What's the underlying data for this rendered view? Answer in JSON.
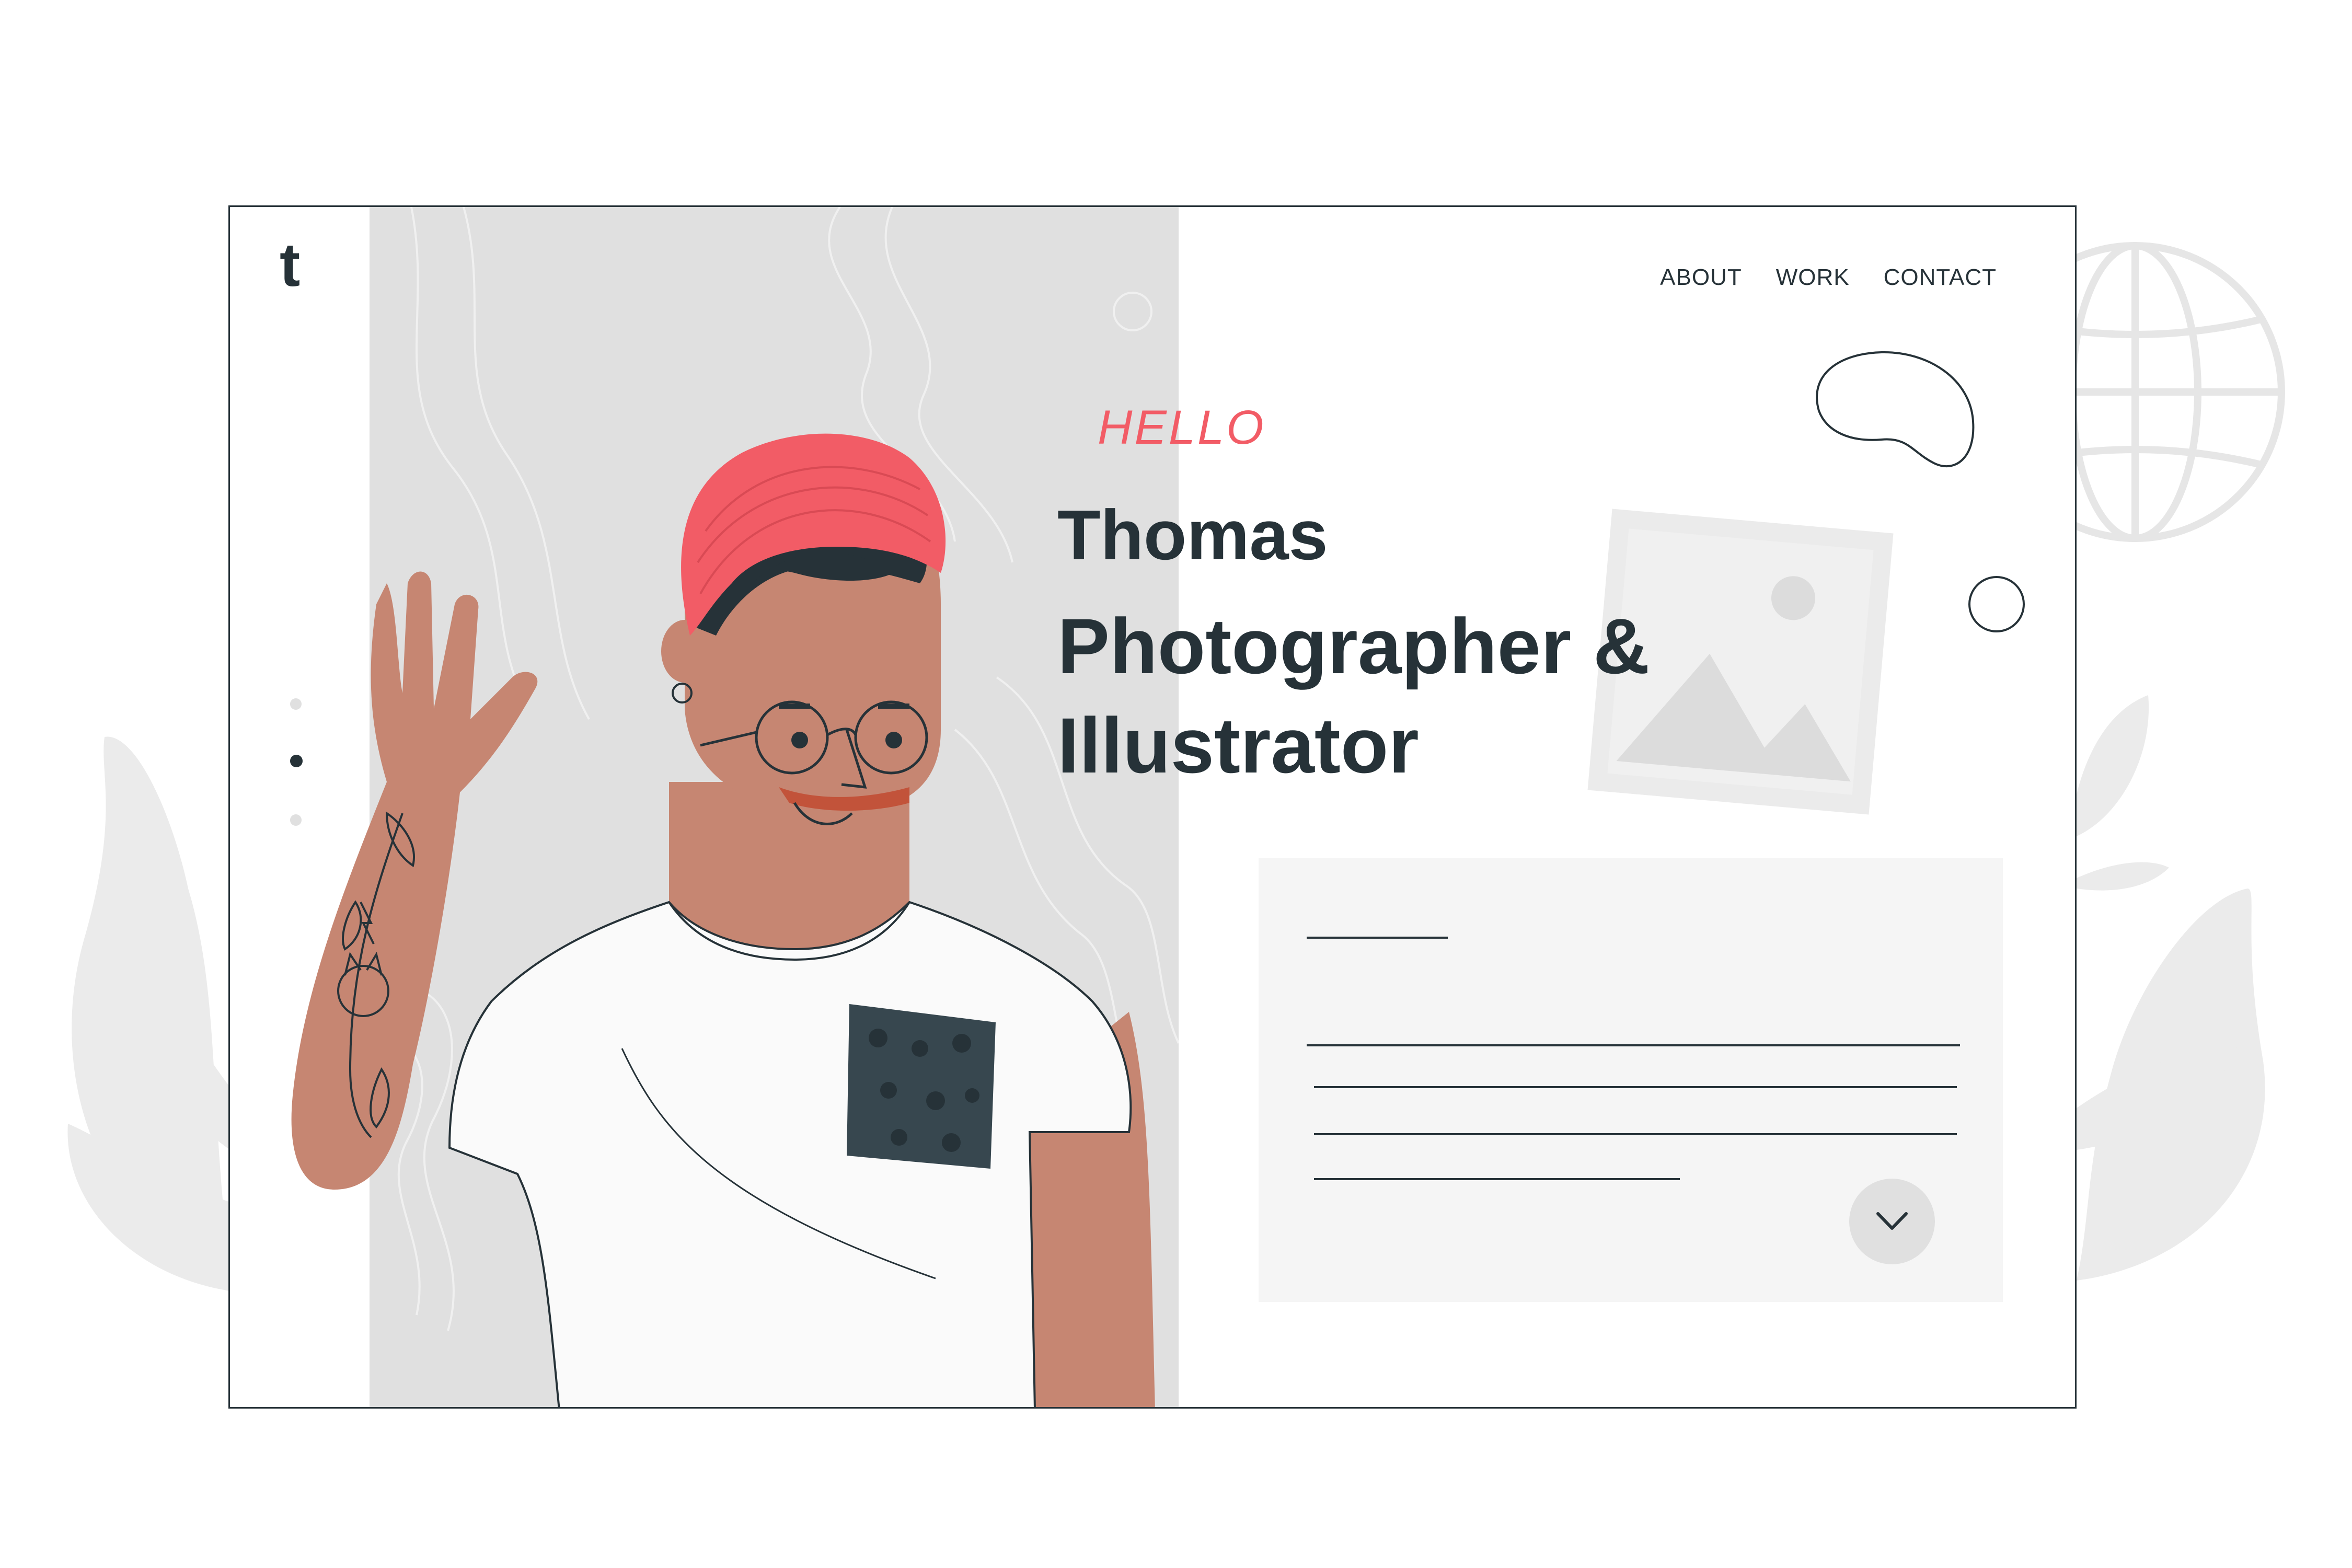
{
  "logo": {
    "text": "t"
  },
  "nav": {
    "items": [
      {
        "label": "ABOUT"
      },
      {
        "label": "WORK"
      },
      {
        "label": "CONTACT"
      }
    ]
  },
  "hero": {
    "greeting": "HELLO",
    "name": "Thomas",
    "profession": "Photographer & Illustrator"
  },
  "pager": {
    "active_index": 1,
    "count": 3
  },
  "scroll_button": {
    "icon": "chevron-down-icon"
  },
  "colors": {
    "accent": "#f25c66",
    "text": "#263238",
    "panel": "#e0e0e0",
    "card": "#f5f5f5",
    "skin": "#c68672",
    "beanie": "#f25c66",
    "pocket": "#37474f"
  }
}
